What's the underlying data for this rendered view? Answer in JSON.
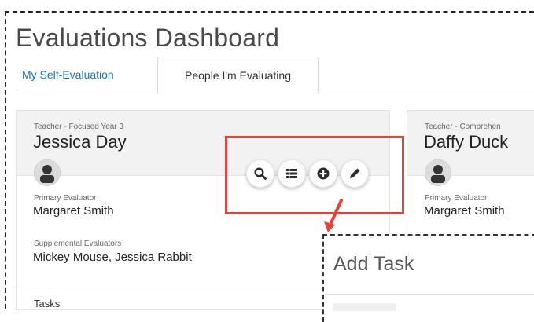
{
  "page": {
    "title": "Evaluations Dashboard"
  },
  "tabs": [
    {
      "label": "My Self-Evaluation",
      "active": false
    },
    {
      "label": "People I'm Evaluating",
      "active": true
    }
  ],
  "cards": [
    {
      "role": "Teacher - Focused Year 3",
      "name": "Jessica Day",
      "primary_label": "Primary Evaluator",
      "primary_value": "Margaret Smith",
      "supplemental_label": "Supplemental Evaluators",
      "supplemental_value": "Mickey Mouse, Jessica Rabbit",
      "tasks_label": "Tasks",
      "actions": [
        {
          "name": "search-icon"
        },
        {
          "name": "list-icon"
        },
        {
          "name": "add-icon"
        },
        {
          "name": "edit-icon"
        }
      ]
    },
    {
      "role": "Teacher - Comprehen",
      "name": "Daffy Duck",
      "primary_label": "Primary Evaluator",
      "primary_value": "Margaret Smith"
    }
  ],
  "popup": {
    "title": "Add Task"
  },
  "colors": {
    "accent": "#1a73b8",
    "highlight": "#e0453a",
    "header_bg": "#f2f2f2",
    "icon_dark": "#2b2b2b"
  }
}
